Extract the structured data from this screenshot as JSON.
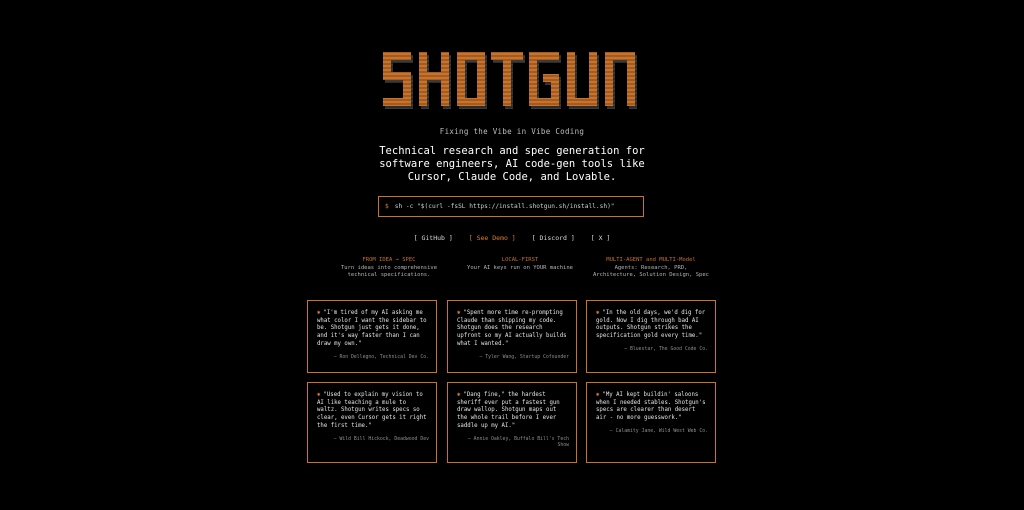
{
  "brand": {
    "logo_text": "SHOTGUN",
    "accent": "#c8722b"
  },
  "tagline": "Fixing the Vibe in Vibe Coding",
  "headline": "Technical research and spec generation for software engineers, AI code-gen tools like Cursor, Claude Code, and Lovable.",
  "install": {
    "prompt": "$",
    "command": "sh -c \"$(curl -fsSL https://install.shotgun.sh/install.sh)\""
  },
  "nav": [
    {
      "label": "[ GitHub ]"
    },
    {
      "label": "[ See Demo ]"
    },
    {
      "label": "[ Discord ]"
    },
    {
      "label": "[ X ]"
    }
  ],
  "features": [
    {
      "title": "FROM IDEA → SPEC",
      "desc": "Turn ideas into comprehensive technical specifications."
    },
    {
      "title": "LOCAL-FIRST",
      "desc": "Your AI keys run on YOUR machine"
    },
    {
      "title": "MULTI-AGENT and MULTI-Model",
      "desc": "Agents: Research, PRD, Architecture, Solution Design, Spec"
    }
  ],
  "testimonials": [
    {
      "icon": "star-icon",
      "quote": "\"I'm tired of my AI asking me what color I want the sidebar to be. Shotgun just gets it done, and it's way faster than I can draw my own.\"",
      "author": "— Ron Dellegno, Technical Dev Co."
    },
    {
      "icon": "star-icon",
      "quote": "\"Spent more time re-prompting Claude than shipping my code. Shotgun does the research upfront so my AI actually builds what I wanted.\"",
      "author": "— Tyler Wang, Startup Cofounder"
    },
    {
      "icon": "star-icon",
      "quote": "\"In the old days, we'd dig for gold. Now I dig through bad AI outputs. Shotgun strikes the specification gold every time.\"",
      "author": "— Bluestar, The Good Code Co."
    },
    {
      "icon": "star-icon",
      "quote": "\"Used to explain my vision to AI like teaching a mule to waltz. Shotgun writes specs so clear, even Cursor gets it right the first time.\"",
      "author": "— Wild Bill Hickock, Deadwood Dev"
    },
    {
      "icon": "star-icon",
      "quote": "\"Dang fine,\" the hardest sheriff ever put a fastest gun draw wallop. Shotgun maps out the whole trail before I ever saddle up my AI.\"",
      "author": "— Annie Oakley, Buffalo Bill's Tech Show"
    },
    {
      "icon": "star-icon",
      "quote": "\"My AI kept buildin' saloons when I needed stables. Shotgun's specs are clearer than desert air - no more guesswork.\"",
      "author": "— Calamity Jane, Wild West Web Co."
    }
  ]
}
